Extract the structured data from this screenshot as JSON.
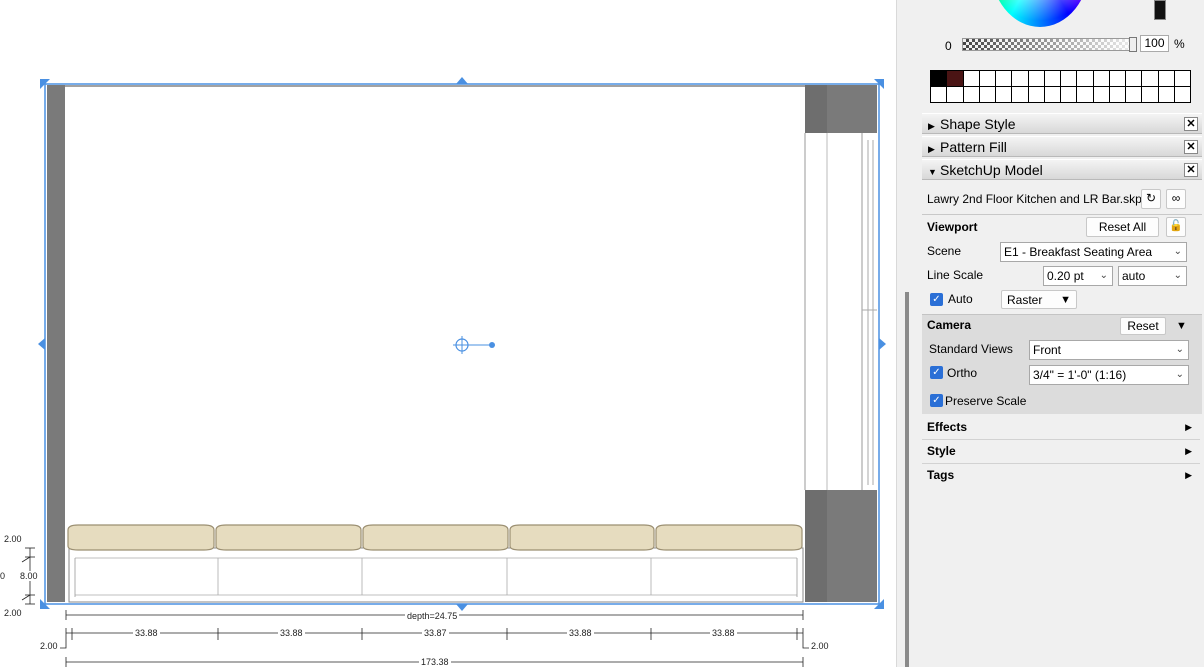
{
  "canvas": {
    "dimensions": {
      "left_top": "2.00",
      "left_mid": "8.00",
      "left_zero": "0",
      "left_bottom": "2.00",
      "depth": "depth=24.75",
      "segment_1": "33.88",
      "segment_2": "33.88",
      "segment_3": "33.87",
      "segment_4": "33.88",
      "segment_5": "33.88",
      "end_left": "2.00",
      "end_right": "2.00",
      "total": "173.38"
    },
    "colors": {
      "selection": "#4a90e2",
      "wall": "#7a7a7a",
      "cushion": "#e6dcbf",
      "cushion_edge": "#9b8f72"
    }
  },
  "panel": {
    "color": {
      "opacity_min": "0",
      "opacity_value": "100",
      "opacity_unit": "%"
    },
    "trays": {
      "shape_style": "Shape Style",
      "pattern_fill": "Pattern Fill",
      "sketchup_model": "SketchUp Model"
    },
    "model": {
      "file_name": "Lawry 2nd Floor Kitchen and LR Bar.skp",
      "viewport_heading": "Viewport",
      "reset_all": "Reset All",
      "scene_label": "Scene",
      "scene_value": "E1 - Breakfast Seating Area",
      "line_scale_label": "Line Scale",
      "line_scale_value": "0.20 pt",
      "line_scale_mode": "auto",
      "auto_label": "Auto",
      "render_mode": "Raster",
      "camera_heading": "Camera",
      "camera_reset": "Reset",
      "standard_views_label": "Standard Views",
      "standard_views_value": "Front",
      "ortho_label": "Ortho",
      "ortho_scale": "3/4\" = 1'-0\" (1:16)",
      "preserve_scale_label": "Preserve Scale",
      "effects": "Effects",
      "style": "Style",
      "tags": "Tags"
    },
    "icons": {
      "close": "close-icon",
      "refresh": "refresh-icon",
      "link": "link-icon",
      "lock": "lock-icon"
    }
  }
}
